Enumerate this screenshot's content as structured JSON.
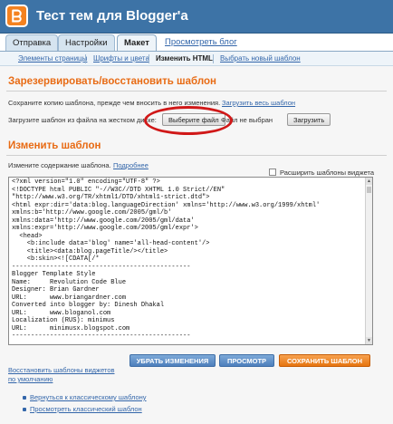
{
  "header": {
    "title": "Тест тем для Blogger'а",
    "logo_icon": "blogger-b-icon"
  },
  "tabs": [
    {
      "label": "Отправка"
    },
    {
      "label": "Настройки"
    },
    {
      "label": "Макет",
      "active": true
    }
  ],
  "view_blog_link": "Просмотреть блог",
  "subnav": [
    {
      "label": "Элементы страницы"
    },
    {
      "label": "Шрифты и цвета"
    },
    {
      "label": "Изменить HTML",
      "active": true
    },
    {
      "label": "Выбрать новый шаблон"
    }
  ],
  "backup": {
    "title": "Зарезервировать/восстановить шаблон",
    "save_text": "Сохраните копию шаблона, прежде чем вносить в него изменения.",
    "download_link": "Загрузить весь шаблон",
    "upload_text": "Загрузите шаблон из файла на жестком диске:",
    "choose_file_label": "Выберите файл",
    "no_file_text": "Файл не выбран",
    "upload_button": "Загрузить"
  },
  "edit": {
    "title": "Изменить шаблон",
    "desc": "Измените содержание шаблона.",
    "more_link": "Подробнее",
    "expand_label": "Расширить шаблоны виджета",
    "expand_checked": false,
    "code": "<?xml version=\"1.0\" encoding=\"UTF-8\" ?>\n<!DOCTYPE html PUBLIC \"-//W3C//DTD XHTML 1.0 Strict//EN\"\n\"http://www.w3.org/TR/xhtml1/DTD/xhtml1-strict.dtd\">\n<html expr:dir='data:blog.languageDirection' xmlns='http://www.w3.org/1999/xhtml'\nxmlns:b='http://www.google.com/2005/gml/b'\nxmlns:data='http://www.google.com/2005/gml/data'\nxmlns:expr='http://www.google.com/2005/gml/expr'>\n  <head>\n    <b:include data='blog' name='all-head-content'/>\n    <title><data:blog.pageTitle/></title>\n    <b:skin><![CDATA[/*\n-----------------------------------------------\nBlogger Template Style\nName:     Revolution Code Blue\nDesigner: Brian Gardner\nURL:      www.briangardner.com\nConverted into blogger by: Dinesh Dhakal\nURL:      www.bloganol.com\nLocalization (RUS): minimus\nURL:      minimusx.blogspot.com\n-----------------------------------------------"
  },
  "actions": {
    "restore_link_line1": "Восстановить шаблоны виджетов",
    "restore_link_line2": "по умолчанию",
    "save_changes": "УБРАТЬ ИЗМЕНЕНИЯ",
    "preview": "ПРОСМОТР",
    "save_template": "СОХРАНИТЬ ШАБЛОН"
  },
  "footer_links": [
    {
      "label": "Вернуться к классическому шаблону"
    },
    {
      "label": "Просмотреть классический шаблон"
    }
  ],
  "colors": {
    "header_bg": "#3d73a6",
    "section_title": "#e86b14",
    "link": "#3366aa",
    "highlight_ellipse": "#d01818",
    "primary_button": "#4d7fbc",
    "save_button": "#e6740f"
  }
}
